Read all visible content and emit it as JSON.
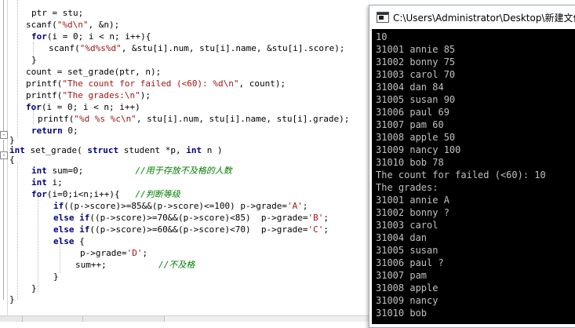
{
  "editor": {
    "code_lines": [
      {
        "t": "ptr = stu;"
      },
      {
        "t": "scanf(\"%d\\n\", &n);"
      },
      {
        "t": "for(i = 0; i < n; i++){"
      },
      {
        "t": "scanf(\"%d%s%d\", &stu[i].num, stu[i].name, &stu[i].score);"
      },
      {
        "t": "}"
      },
      {
        "t": "count = set_grade(ptr, n);"
      },
      {
        "t": "printf(\"The count for failed (<60): %d\\n\", count);"
      },
      {
        "t": "printf(\"The grades:\\n\");"
      },
      {
        "t": "for(i = 0; i < n; i++)"
      },
      {
        "t": "printf(\"%d %s %c\\n\", stu[i].num, stu[i].name, stu[i].grade);"
      },
      {
        "t": "return 0;"
      },
      {
        "t": "}"
      },
      {
        "t": "int set_grade( struct student *p, int n )"
      },
      {
        "t": "{"
      },
      {
        "t": "int sum=0;          //用于存放不及格的人数"
      },
      {
        "t": "int i;"
      },
      {
        "t": "for(i=0;i<n;i++){   //判断等级"
      },
      {
        "t": "if((p->score)>=85&&(p->score)<=100) p->grade='A';"
      },
      {
        "t": "else if((p->score)>=70&&(p->score)<85)  p->grade='B';"
      },
      {
        "t": "else if((p->score)>=60&&(p->score)<70)  p->grade='C';"
      },
      {
        "t": "else {"
      },
      {
        "t": "p->grade='D';"
      },
      {
        "t": "sum++;          //不及格"
      },
      {
        "t": "}"
      },
      {
        "t": ""
      },
      {
        "t": "}"
      },
      {
        "t": "}"
      }
    ],
    "fold_markers": [
      "-",
      "-"
    ]
  },
  "console": {
    "title": "C:\\Users\\Administrator\\Desktop\\新建文件",
    "lines": [
      "10",
      "31001 annie 85",
      "31002 bonny 75",
      "31003 carol 70",
      "31004 dan 84",
      "31005 susan 90",
      "31006 paul 69",
      "31007 pam 60",
      "31008 apple 50",
      "31009 nancy 100",
      "31010 bob 78",
      "The count for failed (<60): 10",
      "The grades:",
      "31001 annie A",
      "31002 bonny ?",
      "31003 carol",
      "31004 dan",
      "31005 susan",
      "31006 paul ?",
      "31007 pam",
      "31008 apple",
      "31009 nancy",
      "31010 bob"
    ]
  }
}
